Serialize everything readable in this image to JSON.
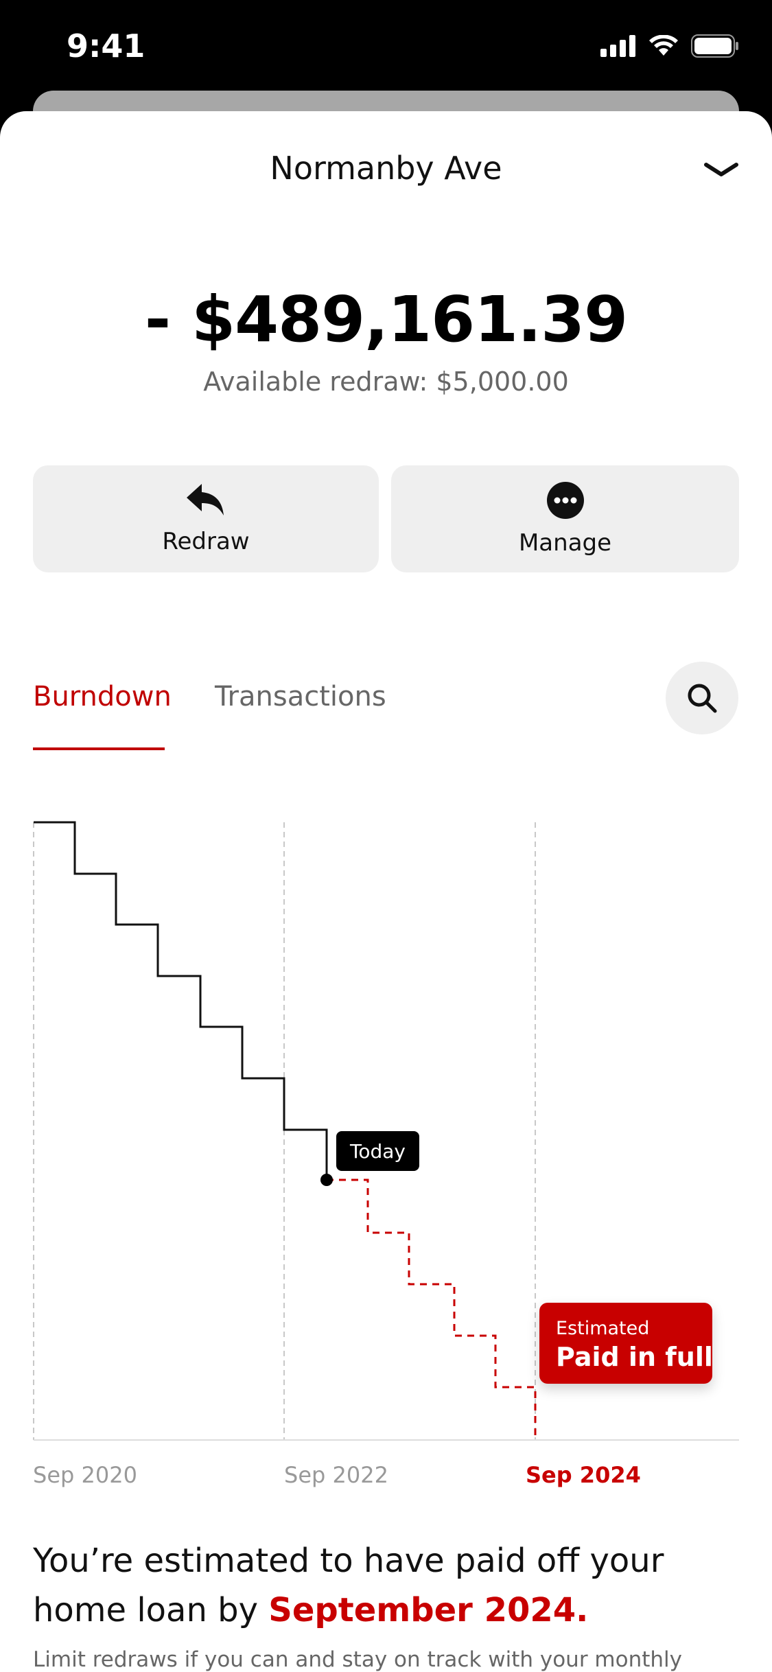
{
  "status_bar": {
    "time": "9:41"
  },
  "header": {
    "title": "Normanby Ave",
    "collapse_icon": "chevron-down-icon"
  },
  "account": {
    "balance": "- $489,161.39",
    "available_redraw": "Available redraw: $5,000.00"
  },
  "actions": [
    {
      "label": "Redraw",
      "icon": "redraw-arrow-icon"
    },
    {
      "label": "Manage",
      "icon": "more-dots-icon"
    }
  ],
  "tabs": [
    {
      "label": "Burndown",
      "active": true
    },
    {
      "label": "Transactions",
      "active": false
    }
  ],
  "colors": {
    "accent": "#c80000",
    "button_bg": "#efefef"
  },
  "chart_data": {
    "type": "line",
    "x_tick_labels": [
      "Sep 2020",
      "Sep 2022",
      "Sep 2024"
    ],
    "highlighted_tick": "Sep 2024",
    "series": [
      {
        "style": "solid",
        "color": "#000000",
        "steps": 7
      },
      {
        "style": "dashed",
        "color": "#c80000",
        "steps": 5
      }
    ],
    "today_label": "Today",
    "end_annotation": {
      "small": "Estimated",
      "big": "Paid in full"
    }
  },
  "summary": {
    "text_before": "You’re estimated to have paid off your home loan by ",
    "highlight": "September 2024.",
    "footnote": "Limit redraws if you can and stay on track with your monthly"
  }
}
